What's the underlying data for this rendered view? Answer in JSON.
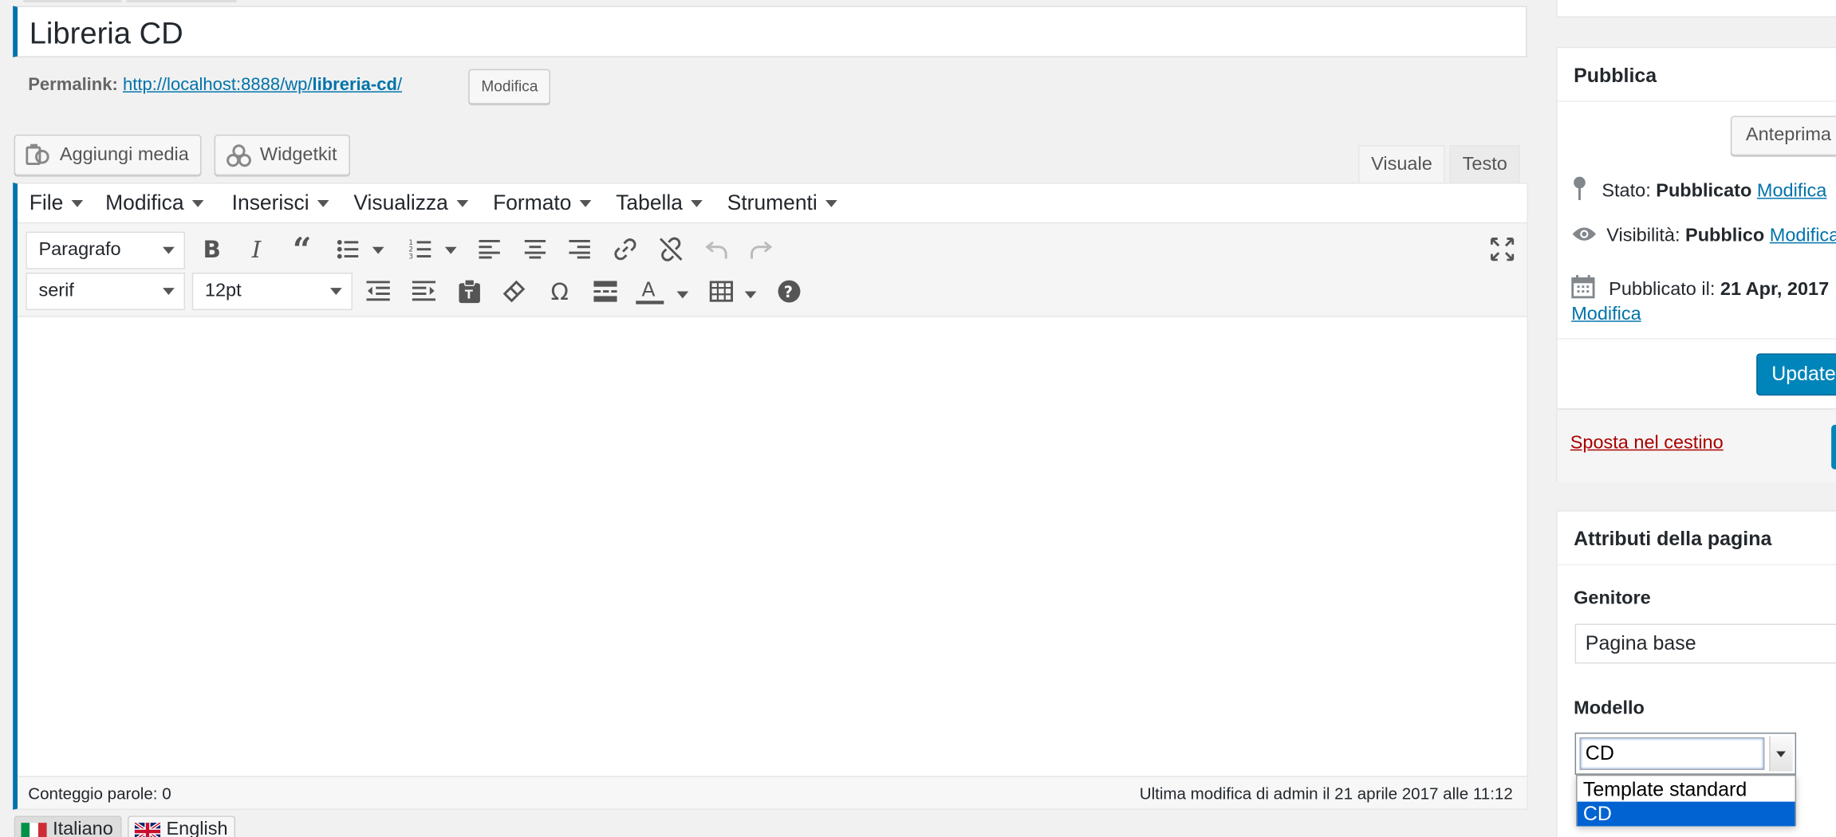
{
  "title": "Libreria CD",
  "permalink": {
    "label": "Permalink:",
    "url_prefix": "http://localhost:8888/wp/",
    "slug": "libreria-cd",
    "url_suffix": "/",
    "edit_button": "Modifica"
  },
  "media_buttons": {
    "add_media": "Aggiungi media",
    "widgetkit": "Widgetkit"
  },
  "editor_tabs": {
    "visual": "Visuale",
    "text": "Testo",
    "active": "visual"
  },
  "menubar": [
    "File",
    "Modifica",
    "Inserisci",
    "Visualizza",
    "Formato",
    "Tabella",
    "Strumenti"
  ],
  "toolbar": {
    "format_select": "Paragrafo",
    "font_family_select": "serif",
    "font_size_select": "12pt",
    "row1_icons": [
      "bold-icon",
      "italic-icon",
      "blockquote-icon",
      "bullet-list-icon",
      "numbered-list-icon",
      "align-left-icon",
      "align-center-icon",
      "align-right-icon",
      "link-icon",
      "unlink-icon",
      "undo-icon",
      "redo-icon",
      "fullscreen-icon"
    ],
    "row2_icons": [
      "outdent-icon",
      "indent-icon",
      "paste-text-icon",
      "clear-format-icon",
      "special-char-icon",
      "read-more-icon",
      "text-color-icon",
      "table-icon",
      "help-icon"
    ]
  },
  "statusbar": {
    "word_count": "Conteggio parole: 0",
    "last_modified": "Ultima modifica di admin il 21 aprile 2017 alle 11:12"
  },
  "languages": [
    {
      "label": "Italiano",
      "active": true
    },
    {
      "label": "English",
      "active": false
    }
  ],
  "publish_box": {
    "heading": "Pubblica",
    "preview_button": "Anteprima",
    "status_label": "Stato:",
    "status_value": "Pubblicato",
    "status_edit": "Modifica",
    "visibility_label": "Visibilità:",
    "visibility_value": "Pubblico",
    "visibility_edit": "Modifica",
    "published_label": "Pubblicato il:",
    "published_value": "21 Apr, 2017",
    "published_edit": "Modifica",
    "update_button": "Update",
    "trash_link": "Sposta nel cestino"
  },
  "page_attributes": {
    "heading": "Attributi della pagina",
    "parent_label": "Genitore",
    "parent_value": "Pagina base",
    "template_label": "Modello",
    "template_value": "CD",
    "template_options": [
      "Template standard",
      "CD"
    ],
    "template_selected": "CD"
  },
  "colors": {
    "accent": "#0073aa",
    "primary_button": "#0085ba",
    "trash": "#a00000",
    "dropdown_selection": "#0063d1"
  }
}
